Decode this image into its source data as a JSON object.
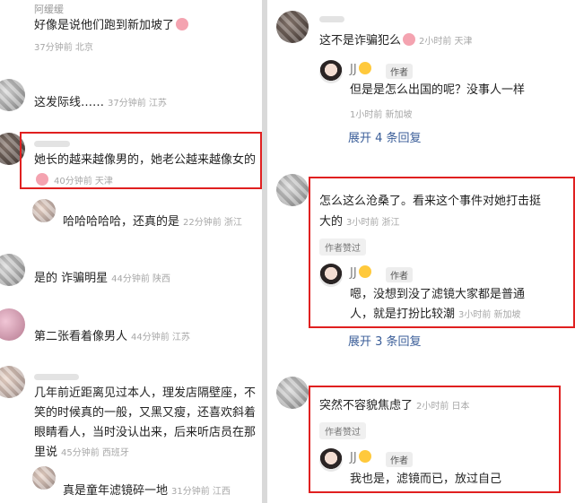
{
  "left": {
    "top_name": "阿缓缓",
    "comments": [
      {
        "text": "好像是说他们跑到新加坡了",
        "emoji": "pig-face-icon",
        "meta": "37分钟前 北京"
      },
      {
        "text": "这发际线……",
        "meta": "37分钟前 江苏"
      },
      {
        "text_line1": "她长的越来越像男的，她老公越来越像女的",
        "emoji": "pig-face-icon",
        "meta": "40分钟前 天津"
      },
      {
        "text": "哈哈哈哈哈，还真的是",
        "meta": "22分钟前 浙江"
      },
      {
        "text": "是的 诈骗明星",
        "meta": "44分钟前 陕西"
      },
      {
        "text": "第二张看着像男人",
        "meta": "44分钟前 江苏"
      },
      {
        "lines": [
          "几年前近距离见过本人，理发店隔壁座，不",
          "笑的时候真的一般，又黑又瘦，还喜欢斜着",
          "眼睛看人，当时没认出来，后来听店员在那"
        ],
        "last_line": "里说",
        "meta": "45分钟前 西班牙"
      },
      {
        "text": "真是童年滤镜碎一地",
        "meta": "31分钟前 江西"
      }
    ]
  },
  "right": {
    "c1": {
      "text": "这不是诈骗犯么",
      "meta": "2小时前 天津"
    },
    "r1": {
      "name": "JJ",
      "badge": "作者",
      "text": "但是是怎么出国的呢？没事人一样",
      "meta": "1小时前 新加坡"
    },
    "expand1": "展开 4 条回复",
    "c2": {
      "line1": "怎么这么沧桑了。看来这个事件对她打击挺",
      "line2": "大的",
      "meta": "3小时前 浙江",
      "liked": "作者赞过"
    },
    "r2": {
      "name": "JJ",
      "badge": "作者",
      "line1": "嗯，没想到没了滤镜大家都是普通",
      "line2": "人，就是打扮比较潮",
      "meta": "3小时前 新加坡"
    },
    "expand2": "展开 3 条回复",
    "c3": {
      "text": "突然不容貌焦虑了",
      "meta": "2小时前 日本",
      "liked": "作者赞过"
    },
    "r3": {
      "name": "JJ",
      "badge": "作者",
      "text": "我也是，滤镜而已，放过自己"
    }
  }
}
